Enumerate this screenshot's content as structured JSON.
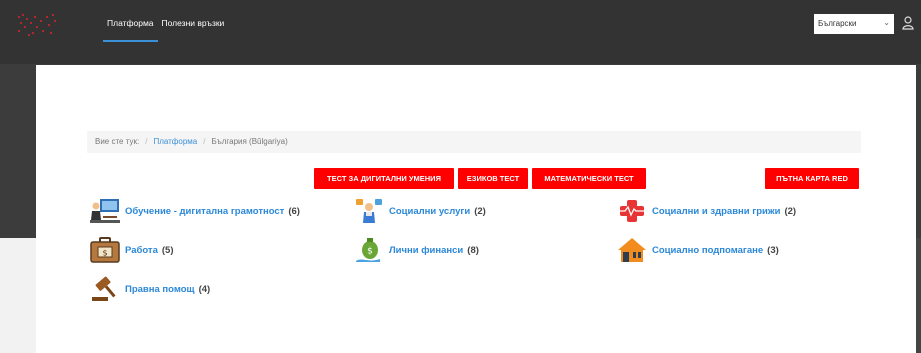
{
  "nav": {
    "items": [
      "Платформа",
      "Полезни връзки"
    ]
  },
  "language": {
    "selected": "Български"
  },
  "breadcrumb": {
    "prefix": "Вие сте тук:",
    "items": [
      "Платформа",
      "България (Bŭlgariya)"
    ]
  },
  "buttons": [
    "ТЕСТ ЗА ДИГИТАЛНИ УМЕНИЯ",
    "ЕЗИКОВ ТЕСТ",
    "МАТЕМАТИЧЕСКИ ТЕСТ",
    "ПЪТНА КАРТА RED"
  ],
  "categories": [
    {
      "name": "Обучение - дигитална грамотност",
      "count": "(6)",
      "icon": "education-icon"
    },
    {
      "name": "Социални услуги",
      "count": "(2)",
      "icon": "social-services-icon"
    },
    {
      "name": "Социални и здравни грижи",
      "count": "(2)",
      "icon": "health-care-icon"
    },
    {
      "name": "Работа",
      "count": "(5)",
      "icon": "briefcase-icon"
    },
    {
      "name": "Лични финанси",
      "count": "(8)",
      "icon": "money-bag-icon"
    },
    {
      "name": "Социално подпомагане",
      "count": "(3)",
      "icon": "house-icon"
    },
    {
      "name": "Правна помощ",
      "count": "(4)",
      "icon": "gavel-icon"
    }
  ],
  "colors": {
    "topbar": "#333333",
    "accent": "#2b88d8",
    "button": "#ff0000"
  }
}
